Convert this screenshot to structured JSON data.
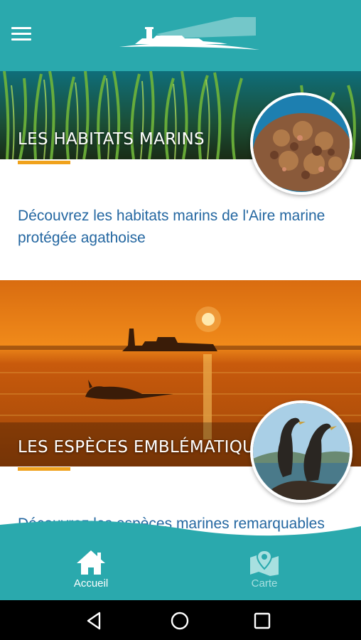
{
  "header": {
    "menu_icon": "hamburger-menu-icon",
    "logo": "lighthouse-fort-logo",
    "brand_color": "#2aa9ad"
  },
  "cards": [
    {
      "title": "LES HABITATS MARINS",
      "description": "Découvrez les habitats marins de l'Aire marine protégée agathoise",
      "banner": "seagrass-meadow-photo",
      "thumbnail": "coralligenous-rock-photo"
    },
    {
      "title": "LES ESPÈCES EMBLÉMATIQUES",
      "description": "Découvrez les espèces marines remarquables",
      "banner": "sunset-dolphin-photo",
      "thumbnail": "cormorants-photo"
    }
  ],
  "accent_color": "#f0a21c",
  "text_link_color": "#2467a1",
  "bottom_nav": {
    "items": [
      {
        "label": "Accueil",
        "icon": "home-icon",
        "active": true
      },
      {
        "label": "Carte",
        "icon": "map-pin-icon",
        "active": false
      }
    ]
  },
  "system_nav": {
    "back": "back-triangle-icon",
    "home": "home-circle-icon",
    "recents": "recents-square-icon"
  }
}
